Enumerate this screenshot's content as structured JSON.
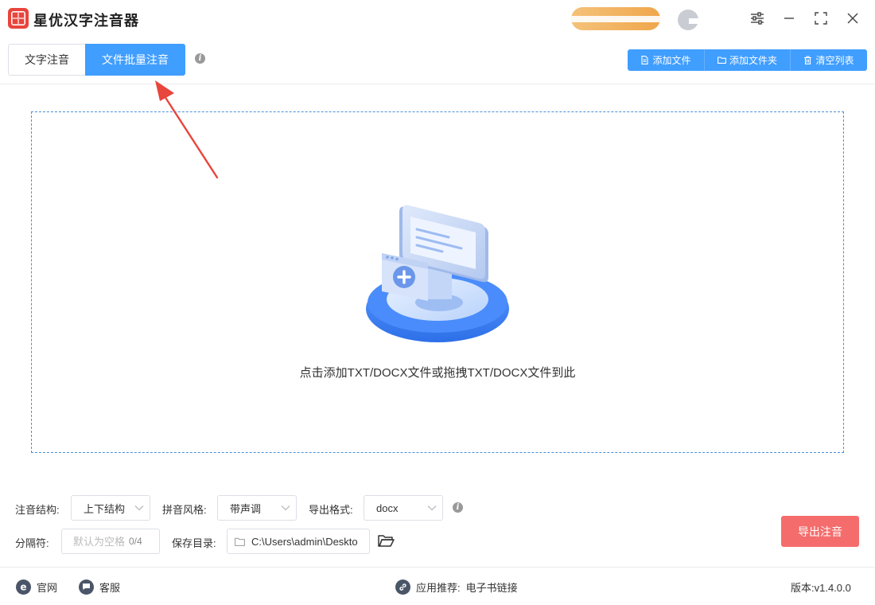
{
  "app": {
    "title": "星优汉字注音器"
  },
  "tabs": [
    {
      "label": "文字注音",
      "active": false
    },
    {
      "label": "文件批量注音",
      "active": true
    }
  ],
  "toolbar": {
    "add_file": "添加文件",
    "add_folder": "添加文件夹",
    "clear_list": "清空列表"
  },
  "dropzone": {
    "hint": "点击添加TXT/DOCX文件或拖拽TXT/DOCX文件到此"
  },
  "settings": {
    "structure_label": "注音结构:",
    "structure_value": "上下结构",
    "style_label": "拼音风格:",
    "style_value": "带声调",
    "format_label": "导出格式:",
    "format_value": "docx",
    "separator_label": "分隔符:",
    "separator_placeholder": "默认为空格",
    "separator_count": "0/4",
    "save_dir_label": "保存目录:",
    "save_dir_value": "C:\\Users\\admin\\Deskto"
  },
  "export_button": "导出注音",
  "footer": {
    "website": "官网",
    "support": "客服",
    "recommend_label": "应用推荐:",
    "recommend_link": "电子书链接",
    "version": "版本:v1.4.0.0"
  },
  "colors": {
    "primary": "#409eff",
    "danger": "#f56c6c",
    "dropzone_border": "#4a90d9",
    "annotation_arrow": "#e8453c"
  }
}
